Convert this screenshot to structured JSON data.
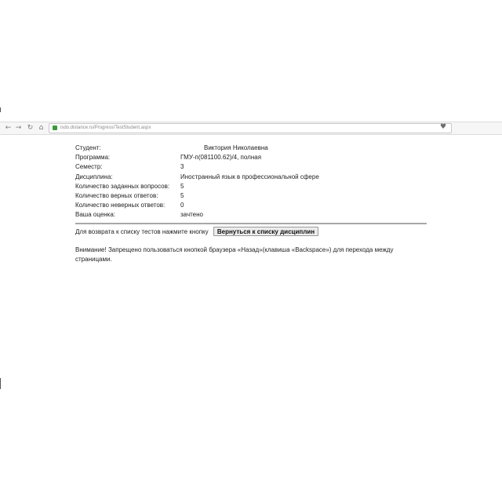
{
  "browser": {
    "back_glyph": "←",
    "forward_glyph": "→",
    "reload_glyph": "↻",
    "home_glyph": "⌂",
    "url": "isdo.distance.ru/Progress/TestStudent.aspx",
    "bookmark_glyph": "♥",
    "icons": {
      "back": "back-arrow-icon",
      "forward": "forward-arrow-icon",
      "reload": "reload-icon",
      "home": "home-icon",
      "lock": "lock-icon",
      "bookmark": "heart-bookmark-icon"
    }
  },
  "results": {
    "student_label": "Студент:",
    "student_value": "Виктория Николаевна",
    "program_label": "Программа:",
    "program_value": "ГМУ-п(081100.62)/4, полная",
    "semester_label": "Семестр:",
    "semester_value": "3",
    "discipline_label": "Дисциплина:",
    "discipline_value": "Иностранный язык в профессиональной сфере",
    "questions_label": "Количество заданных вопросов:",
    "questions_value": "5",
    "correct_label": "Количество верных ответов:",
    "correct_value": "5",
    "wrong_label": "Количество неверных ответов:",
    "wrong_value": "0",
    "grade_label": "Ваша оценка:",
    "grade_value": "зачтено"
  },
  "actions": {
    "return_text": "Для возврата к списку тестов нажмите кнопку",
    "return_button_label": "Вернуться к списку дисциплин"
  },
  "warning": {
    "text": "Внимание! Запрещено пользоваться кнопкой браузера «Назад»(клавиша «Backspace») для перехода между страницами."
  },
  "colors": {
    "page_bg": "#ffffff",
    "text": "#222222",
    "divider": "#a8a8a8",
    "button_bg": "#ececec",
    "lock": "#3a9a3a"
  }
}
